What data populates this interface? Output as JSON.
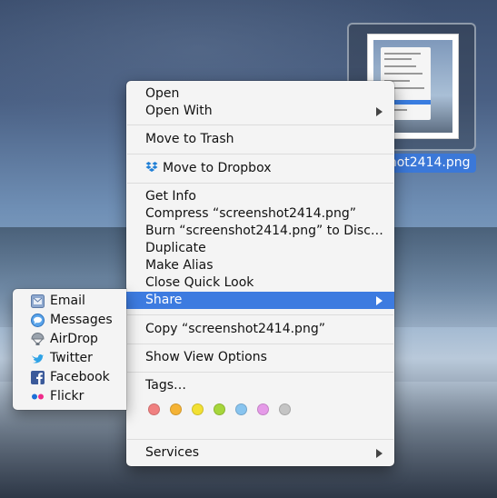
{
  "desktop": {
    "file_name": "screenshot2414.png"
  },
  "context_menu": {
    "groups": [
      [
        "Open",
        "Open With"
      ],
      [
        "Move to Trash"
      ],
      [
        "Move to Dropbox"
      ],
      [
        "Get Info",
        "Compress “screenshot2414.png”",
        "Burn “screenshot2414.png” to Disc…",
        "Duplicate",
        "Make Alias",
        "Close Quick Look",
        "Share"
      ],
      [
        "Copy “screenshot2414.png”"
      ],
      [
        "Show View Options"
      ],
      [
        "Tags…"
      ],
      [
        "Services"
      ]
    ],
    "open": "Open",
    "open_with": "Open With",
    "move_to_trash": "Move to Trash",
    "move_to_dropbox": "Move to Dropbox",
    "get_info": "Get Info",
    "compress": "Compress “screenshot2414.png”",
    "burn": "Burn “screenshot2414.png” to Disc…",
    "duplicate": "Duplicate",
    "make_alias": "Make Alias",
    "close_quick_look": "Close Quick Look",
    "share": "Share",
    "copy": "Copy “screenshot2414.png”",
    "show_view_options": "Show View Options",
    "tags": "Tags…",
    "services": "Services",
    "highlighted_item": "Share",
    "tag_colors": [
      "#f08080",
      "#f5b335",
      "#f2e033",
      "#a6d63b",
      "#88c4ef",
      "#e59ae8",
      "#c4c4c4"
    ]
  },
  "share_menu": {
    "email": "Email",
    "messages": "Messages",
    "airdrop": "AirDrop",
    "twitter": "Twitter",
    "facebook": "Facebook",
    "flickr": "Flickr"
  },
  "colors": {
    "highlight": "#3d7be0",
    "menu_bg": "#f4f4f4"
  }
}
